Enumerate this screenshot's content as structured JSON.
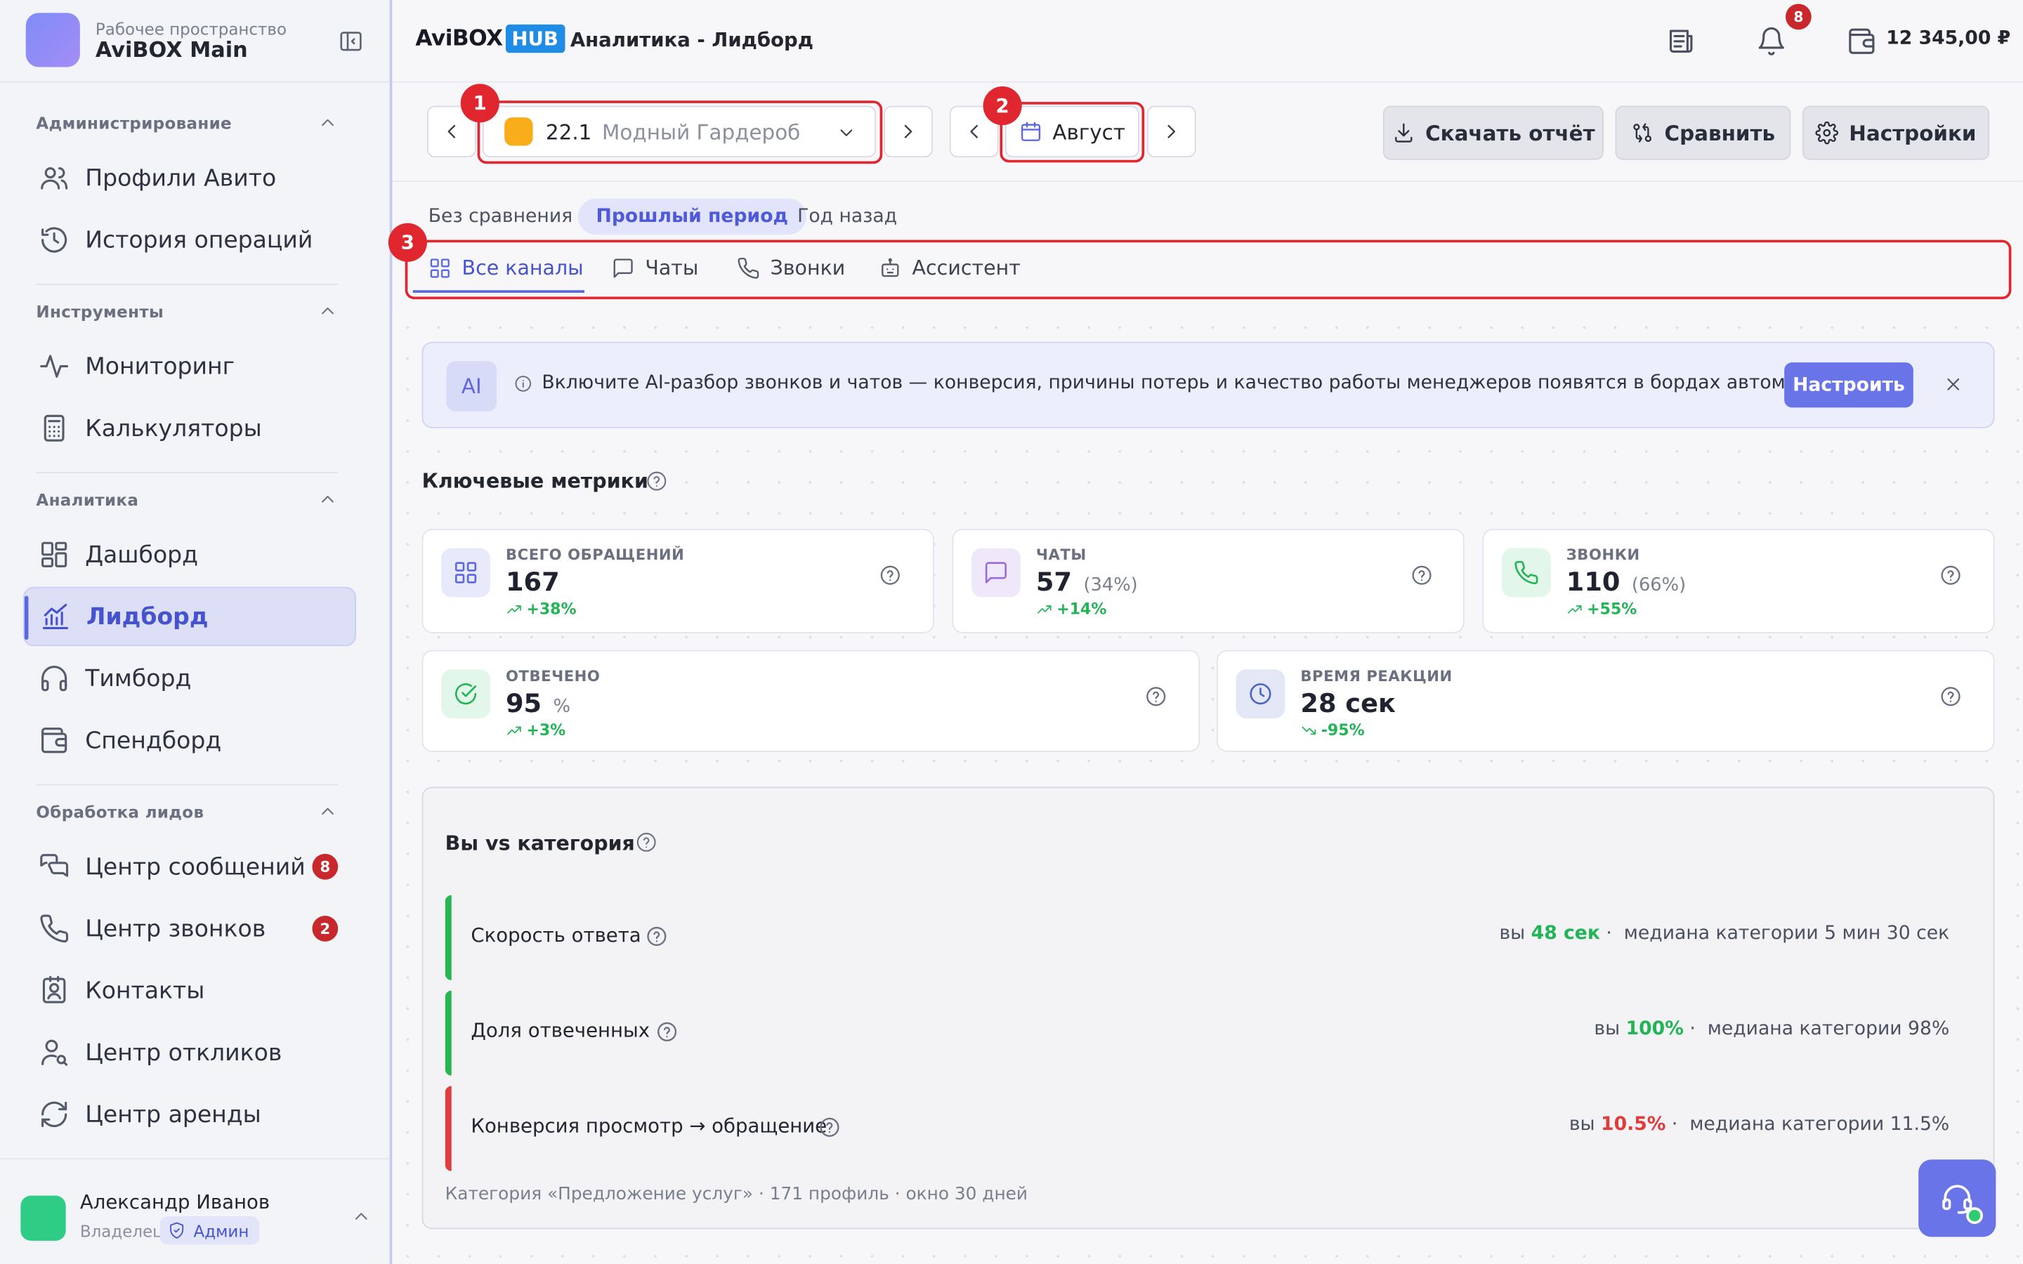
{
  "workspace": {
    "label": "Рабочее пространство",
    "name": "AviBOX Main"
  },
  "sidebar": {
    "sections": [
      {
        "title": "Администрирование",
        "items": [
          {
            "label": "Профили Авито",
            "icon": "users-icon"
          },
          {
            "label": "История операций",
            "icon": "history-icon"
          }
        ]
      },
      {
        "title": "Инструменты",
        "items": [
          {
            "label": "Мониторинг",
            "icon": "activity-icon"
          },
          {
            "label": "Калькуляторы",
            "icon": "calculator-icon"
          }
        ]
      },
      {
        "title": "Аналитика",
        "items": [
          {
            "label": "Дашборд",
            "icon": "dashboard-icon"
          },
          {
            "label": "Лидборд",
            "icon": "chart-icon",
            "active": true
          },
          {
            "label": "Тимборд",
            "icon": "headphones-icon"
          },
          {
            "label": "Спендборд",
            "icon": "wallet-icon"
          }
        ]
      },
      {
        "title": "Обработка лидов",
        "items": [
          {
            "label": "Центр сообщений",
            "icon": "messages-icon",
            "badge": "8"
          },
          {
            "label": "Центр звонков",
            "icon": "phone-icon",
            "badge": "2"
          },
          {
            "label": "Контакты",
            "icon": "contacts-icon"
          },
          {
            "label": "Центр откликов",
            "icon": "user-search-icon"
          },
          {
            "label": "Центр аренды",
            "icon": "refresh-icon"
          }
        ]
      }
    ]
  },
  "user": {
    "name": "Александр Иванов",
    "role": "Владелец",
    "badge": "Админ"
  },
  "header": {
    "logo_left": "AviBOX",
    "logo_right": "HUB",
    "title": "Аналитика - Лидборд",
    "notifications": "8",
    "balance": "12 345,00 ₽"
  },
  "controls": {
    "shop_number": "22.1",
    "shop_name": "Модный Гардероб",
    "month": "Август",
    "download_label": "Скачать отчёт",
    "compare_label": "Сравнить",
    "settings_label": "Настройки",
    "markers": [
      "1",
      "2",
      "3"
    ]
  },
  "comparison": [
    "Без сравнения",
    "Прошлый период",
    "Год назад"
  ],
  "comparison_active": "Прошлый период",
  "channels": [
    "Все каналы",
    "Чаты",
    "Звонки",
    "Ассистент"
  ],
  "channel_active": "Все каналы",
  "ai_banner": {
    "badge": "AI",
    "text": "Включите AI-разбор звонков и чатов — конверсия, причины потерь и качество работы менеджеров появятся в бордах автоматически.",
    "button": "Настроить"
  },
  "metrics_title": "Ключевые метрики",
  "metrics": [
    {
      "label": "ВСЕГО ОБРАЩЕНИЙ",
      "value": "167",
      "sub": "",
      "delta": "+38%",
      "icon": "grid-icon",
      "color": "#5a67e0"
    },
    {
      "label": "ЧАТЫ",
      "value": "57",
      "sub": "(34%)",
      "delta": "+14%",
      "icon": "chat-icon",
      "color": "#9a6ae0"
    },
    {
      "label": "ЗВОНКИ",
      "value": "110",
      "sub": "(66%)",
      "delta": "+55%",
      "icon": "phone-icon",
      "color": "#22b455"
    },
    {
      "label": "ОТВЕЧЕНО",
      "value": "95",
      "sub": "%",
      "delta": "+3%",
      "icon": "check-circle-icon",
      "color": "#22b455"
    },
    {
      "label": "ВРЕМЯ РЕАКЦИИ",
      "value": "28 сек",
      "sub": "",
      "delta": "-95%",
      "icon": "clock-icon",
      "color": "#4a63c8"
    }
  ],
  "category": {
    "title": "Вы vs категория",
    "rows": [
      {
        "label": "Скорость ответа",
        "you_prefix": "вы",
        "you": "48 сек",
        "median": "медиана категории 5 мин 30 сек",
        "status": "good"
      },
      {
        "label": "Доля отвеченных",
        "you_prefix": "вы",
        "you": "100%",
        "median": "медиана категории 98%",
        "status": "good"
      },
      {
        "label": "Конверсия просмотр → обращение",
        "you_prefix": "вы",
        "you": "10.5%",
        "median": "медиана категории 11.5%",
        "status": "bad"
      }
    ],
    "footer": "Категория «Предложение услуг» · 171 профиль · окно 30 дней"
  }
}
